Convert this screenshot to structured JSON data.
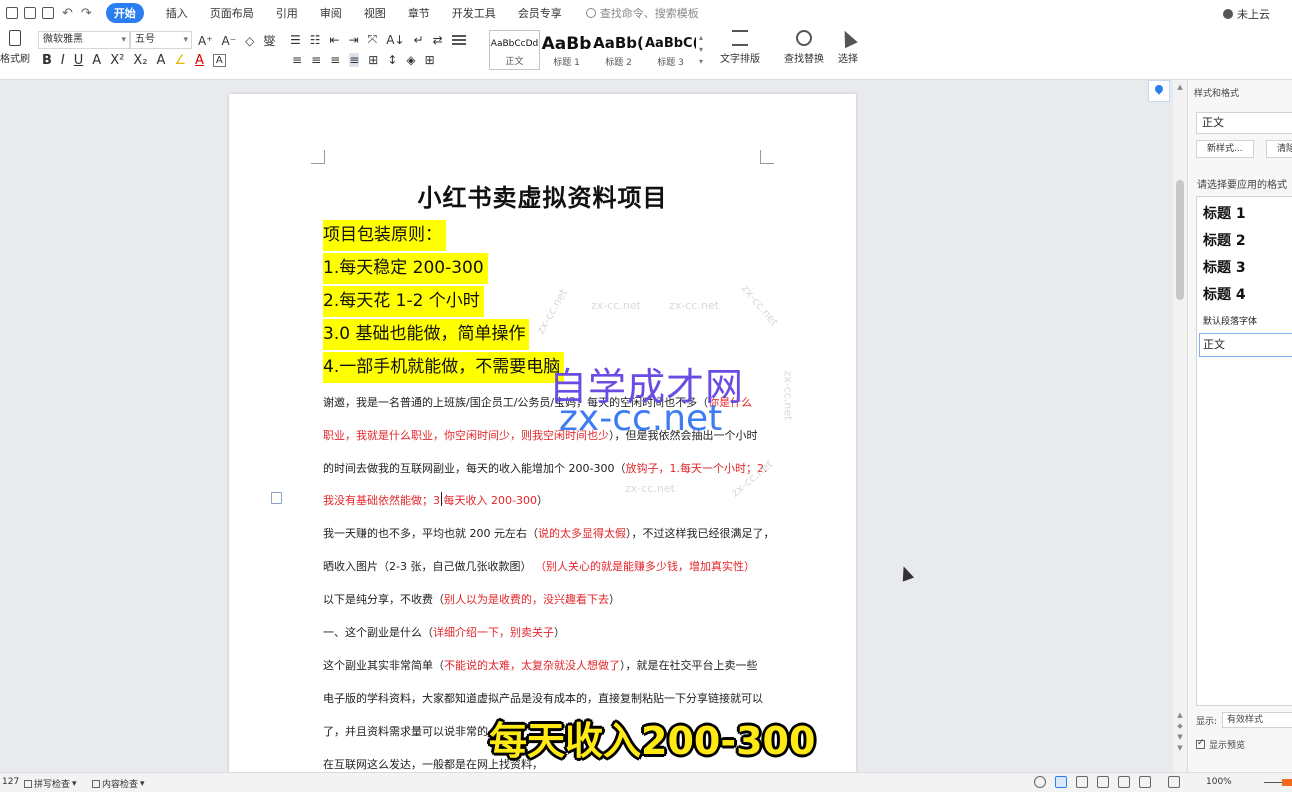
{
  "menubar": {
    "tabs": [
      "开始",
      "插入",
      "页面布局",
      "引用",
      "审阅",
      "视图",
      "章节",
      "开发工具",
      "会员专享"
    ],
    "search_placeholder": "查找命令、搜索模板",
    "cloud_status": "未上云"
  },
  "ribbon": {
    "format_painter_label": "格式刷",
    "font_name": "微软雅黑",
    "font_size": "五号",
    "row1_glyphs": [
      "A⁺",
      "A⁻",
      "◇",
      "燮"
    ],
    "row2_glyphs": [
      "B",
      "I",
      "U",
      "A",
      "X²",
      "X₂",
      "A",
      "∠",
      "A",
      "A"
    ],
    "para_row1": [
      "☰",
      "☷",
      "⇤",
      "⇥",
      "⤧",
      "A↓",
      "↵",
      "⇄"
    ],
    "para_row2": [
      "≡",
      "≡",
      "≡",
      "≡",
      "⊞",
      "↕",
      "◈",
      "⊞"
    ],
    "styles": [
      {
        "sample": "AaBbCcDd",
        "name": "正文"
      },
      {
        "sample": "AaBb",
        "name": "标题 1"
      },
      {
        "sample": "AaBb(",
        "name": "标题 2"
      },
      {
        "sample": "AaBbC(",
        "name": "标题 3"
      }
    ],
    "text_layout_label": "文字排版",
    "find_replace_label": "查找替换",
    "select_label": "选择"
  },
  "document": {
    "title": "小红书卖虚拟资料项目",
    "highlight_lines": [
      "项目包装原则：",
      "1.每天稳定 200-300",
      "2.每天花 1-2 个小时",
      "3.0 基础也能做，简单操作",
      "4.一部手机就能做，不需要电脑"
    ],
    "body_lines": [
      [
        {
          "t": "谢邀，我是一名普通的上班族/国企员工/公务员/宝妈，每天的空闲时间也不多（",
          "red": false
        },
        {
          "t": "你是什么",
          "red": true
        }
      ],
      [
        {
          "t": "职业，我就是什么职业，你空闲时间少，则我空闲时间也少",
          "red": true
        },
        {
          "t": "），但是我依然会抽出一个小时",
          "red": false
        }
      ],
      [
        {
          "t": "的时间去做我的互联网副业，每天的收入能增加个 200-300（",
          "red": false
        },
        {
          "t": "放钩子，1.每天一个小时；2.",
          "red": true
        }
      ],
      [
        {
          "t": "我没有基础依然能做；3.每天收入 200-300",
          "red": true
        },
        {
          "t": "）",
          "red": false
        }
      ],
      [
        {
          "t": "我一天赚的也不多，平均也就 200 元左右（",
          "red": false
        },
        {
          "t": "说的太多显得太假",
          "red": true
        },
        {
          "t": "），不过这样我已经很满足了，",
          "red": false
        }
      ],
      [
        {
          "t": "晒收入图片（2-3 张，自己做几张收款图）        ",
          "red": false
        },
        {
          "t": "（别人关心的就是能赚多少钱，增加真实性）",
          "red": true
        }
      ],
      [
        {
          "t": "以下是纯分享，不收费（",
          "red": false
        },
        {
          "t": "别人以为是收费的，没兴趣看下去",
          "red": true
        },
        {
          "t": "）",
          "red": false
        }
      ],
      [
        {
          "t": "一、这个副业是什么（",
          "red": false
        },
        {
          "t": "详细介绍一下，别卖关子",
          "red": true
        },
        {
          "t": "）",
          "red": false
        }
      ],
      [
        {
          "t": "这个副业其实非常简单（",
          "red": false
        },
        {
          "t": "不能说的太难，太复杂就没人想做了",
          "red": true
        },
        {
          "t": "），就是在社交平台上卖一些",
          "red": false
        }
      ],
      [
        {
          "t": "电子版的学科资料，大家都知道虚拟产品是没有成本的，直接复制粘贴一下分享链接就可以",
          "red": false
        }
      ],
      [
        {
          "t": "了，并且资料需求量可以说非常的",
          "red": false
        }
      ],
      [
        {
          "t": "在互联网这么发达，一般都是在网上找资料，",
          "red": false
        }
      ]
    ],
    "watermark_small": [
      "zx-cc.net",
      "zx-cc.net",
      "zx-cc.net",
      "zx-cc.net",
      "zx-cc.net",
      "zx-cc.net",
      "zx-cc.net"
    ],
    "watermark_cn": "自学成才网",
    "watermark_url": "zx-cc.net",
    "caption": "每天收入200-300"
  },
  "styles_pane": {
    "title": "样式和格式",
    "current_style": "正文",
    "new_style_button": "新样式...",
    "clear_button": "清除",
    "prompt": "请选择要应用的格式",
    "headings": [
      "标题 1",
      "标题 2",
      "标题 3",
      "标题 4"
    ],
    "default_font": "默认段落字体",
    "body_style": "正文",
    "show_label": "显示:",
    "show_value": "有效样式",
    "preview_label": "显示预览"
  },
  "statusbar": {
    "page_number": "127",
    "spell_check": "拼写检查",
    "content_check": "内容检查",
    "zoom": "100%"
  },
  "colors": {
    "accent": "#2a7ef0",
    "highlight": "#ffff00",
    "red_text": "#e3262b",
    "caption": "#ffe914"
  }
}
